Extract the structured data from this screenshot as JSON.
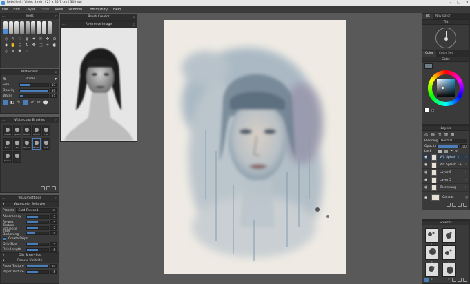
{
  "window": {
    "title": "Rebelle 4 | Violet 3.reb* | 27 x 35.7 cm | 300 dpi",
    "controls": [
      "–",
      "□",
      "✕"
    ]
  },
  "menu": [
    "File",
    "Edit",
    "Layer",
    "Filter",
    "View",
    "Window",
    "Community",
    "Help"
  ],
  "tools": {
    "title": "Tools"
  },
  "watercolor": {
    "title": "Watercolor",
    "brush_name": "Bristle",
    "sliders": [
      {
        "label": "Size",
        "value": "33",
        "fraction": 0.33
      },
      {
        "label": "Opacity",
        "value": "97",
        "fraction": 0.97
      },
      {
        "label": "Water",
        "value": "12",
        "fraction": 0.12
      }
    ]
  },
  "watercolor_brushes": {
    "title": "Watercolor Brushes",
    "items": [
      "Splash",
      "Splash",
      "Round",
      "Round",
      "Flat",
      "Flat 2",
      "Flat Bri",
      "Filbert",
      "Bristle",
      "Soft",
      "Splash",
      ""
    ]
  },
  "visual_settings": {
    "title": "Visual Settings"
  },
  "watercolor_behavior": {
    "title": "Watercolor Behavior",
    "presets_label": "Presets",
    "presets_value": "Cold Pressed",
    "sliders": [
      {
        "label": "Absorbency",
        "value": "5",
        "fraction": 0.5
      },
      {
        "label": "Re-wet",
        "value": "5",
        "fraction": 0.5
      },
      {
        "label": "Texture Influence",
        "value": "5",
        "fraction": 0.5
      },
      {
        "label": "Edge Darkening",
        "value": "4",
        "fraction": 0.4
      }
    ],
    "create_drips_label": "Create Drips",
    "drip_sliders": [
      {
        "label": "Drip Size",
        "value": "5",
        "fraction": 0.5
      },
      {
        "label": "Drip Length",
        "value": "5",
        "fraction": 0.5
      }
    ],
    "sections": [
      "Oils & Acrylics",
      "Canvas Visibility"
    ],
    "paper_sliders": [
      {
        "label": "Paper Texture",
        "value": "10",
        "fraction": 1.0
      },
      {
        "label": "Paper Texture",
        "value": "5",
        "fraction": 0.5
      }
    ]
  },
  "brush_creator": {
    "title": "Brush Creator"
  },
  "reference_image": {
    "title": "Reference Image"
  },
  "right": {
    "tabs": [
      "Tilt",
      "Navigator"
    ],
    "tilt_label": "Tilt",
    "color_tabs": [
      "Color",
      "Color Set"
    ],
    "color_title": "Color",
    "colors": {
      "swatch": "#6d7c85",
      "primary": "#ffffff",
      "secondary": "#000000"
    },
    "layers_title": "Layers",
    "blending_label": "Blending",
    "blending_value": "Normal",
    "opacity_label": "Opacity",
    "opacity_value": "100",
    "opacity_fraction": 1.0,
    "lock_label": "Lock",
    "layers": [
      {
        "name": "WC Splash 1"
      },
      {
        "name": "WC Splash 1+"
      },
      {
        "name": "Layer 6"
      },
      {
        "name": "Layer 5"
      },
      {
        "name": "Zeichnung"
      }
    ],
    "canvas_label": "Canvas",
    "stencils_title": "Stencils",
    "stencils": [
      "1",
      "2",
      "3",
      "4",
      "5",
      "6"
    ]
  }
}
